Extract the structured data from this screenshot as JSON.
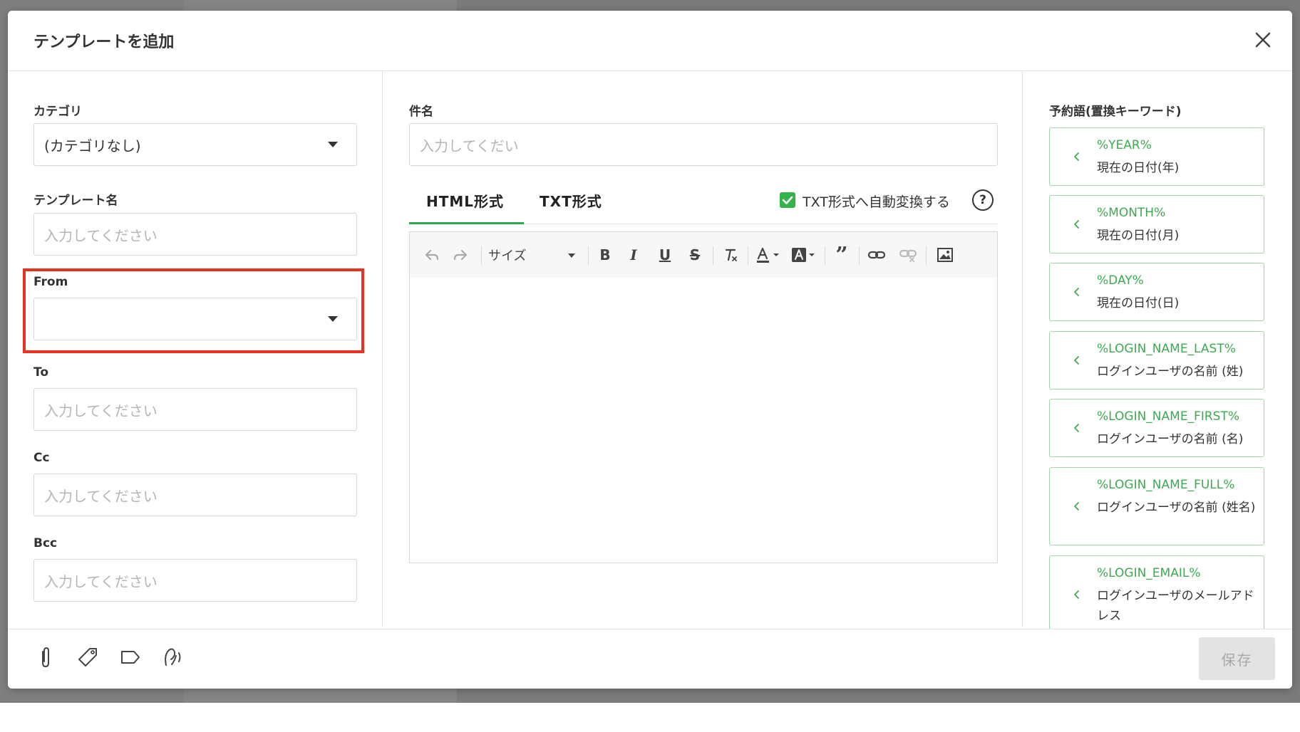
{
  "modal": {
    "title": "テンプレートを追加"
  },
  "left": {
    "category": {
      "label": "カテゴリ",
      "value": "(カテゴリなし)"
    },
    "template_name": {
      "label": "テンプレート名",
      "placeholder": "入力してください"
    },
    "from": {
      "label": "From",
      "value": ""
    },
    "to": {
      "label": "To",
      "placeholder": "入力してください"
    },
    "cc": {
      "label": "Cc",
      "placeholder": "入力してください"
    },
    "bcc": {
      "label": "Bcc",
      "placeholder": "入力してください"
    }
  },
  "center": {
    "subject": {
      "label": "件名",
      "placeholder": "入力してくだい"
    },
    "tabs": [
      {
        "label": "HTML形式",
        "active": true
      },
      {
        "label": "TXT形式",
        "active": false
      }
    ],
    "auto_convert": {
      "label": "TXT形式へ自動変換する",
      "checked": true
    },
    "help": "?",
    "toolbar": {
      "size_label": "サイズ"
    }
  },
  "keywords": {
    "title": "予約語(置換キーワード)",
    "items": [
      {
        "code": "%YEAR%",
        "desc": "現在の日付(年)"
      },
      {
        "code": "%MONTH%",
        "desc": "現在の日付(月)"
      },
      {
        "code": "%DAY%",
        "desc": "現在の日付(日)"
      },
      {
        "code": "%LOGIN_NAME_LAST%",
        "desc": "ログインユーザの名前 (姓)"
      },
      {
        "code": "%LOGIN_NAME_FIRST%",
        "desc": "ログインユーザの名前 (名)"
      },
      {
        "code": "%LOGIN_NAME_FULL%",
        "desc": "ログインユーザの名前 (姓名)"
      },
      {
        "code": "%LOGIN_EMAIL%",
        "desc": "ログインユーザのメールアドレス"
      }
    ]
  },
  "footer": {
    "save_label": "保存"
  },
  "colors": {
    "accent": "#35b34a",
    "highlight": "#e8321f"
  }
}
